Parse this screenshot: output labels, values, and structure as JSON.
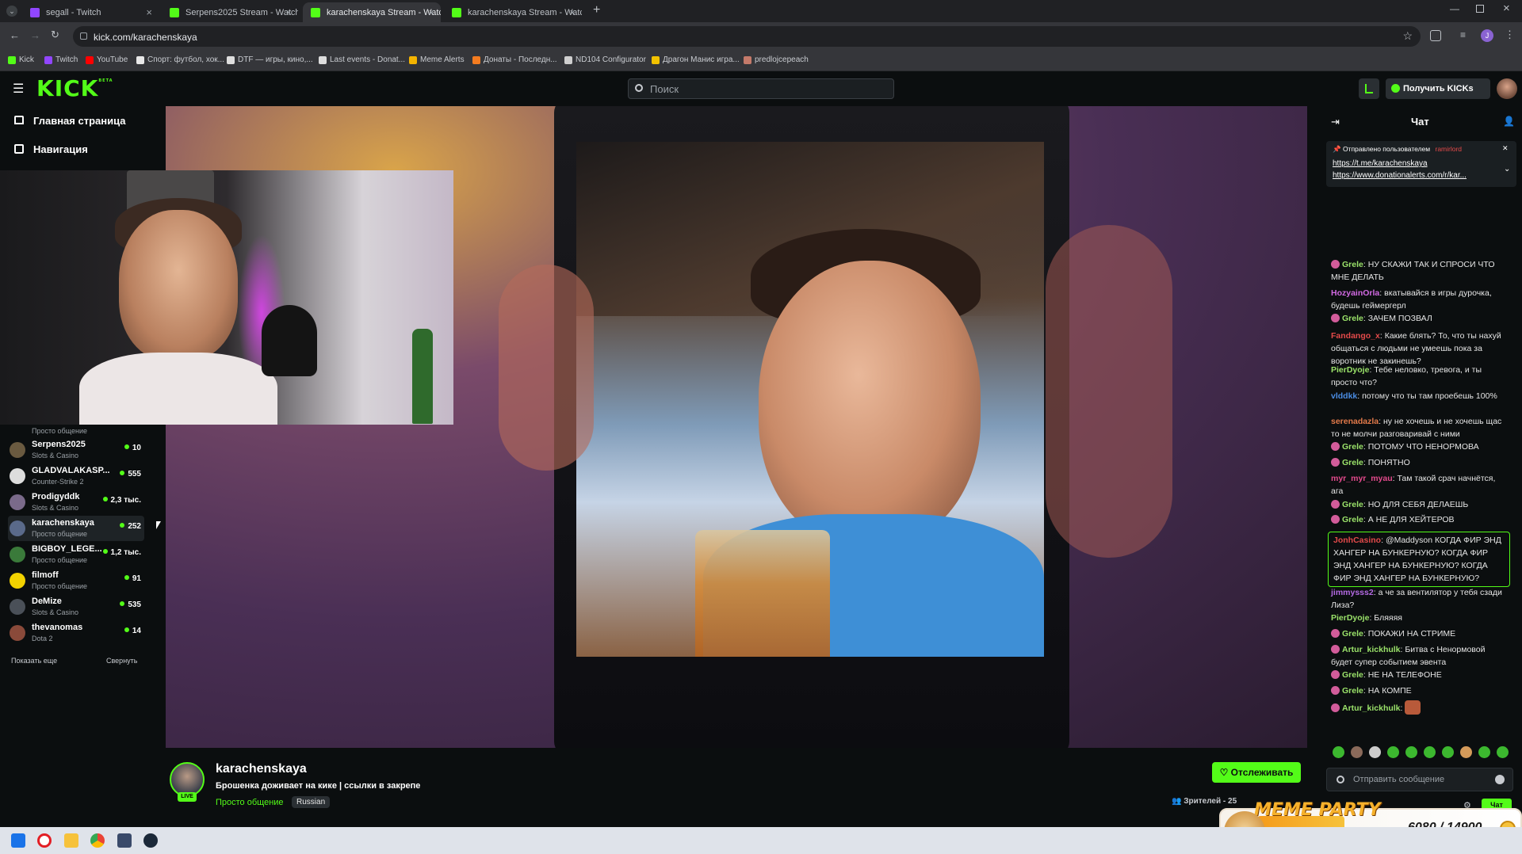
{
  "browser": {
    "tabs": [
      {
        "title": "segall - Twitch",
        "favicon": "twitch-icon"
      },
      {
        "title": "Serpens2025 Stream - Watch L",
        "favicon": "kick-icon"
      },
      {
        "title": "karachenskaya Stream - Watch",
        "favicon": "kick-icon",
        "active": true
      },
      {
        "title": "karachenskaya Stream - Watch",
        "favicon": "kick-icon"
      }
    ],
    "url": "kick.com/karachenskaya",
    "bookmarks": [
      "Kick",
      "Twitch",
      "YouTube",
      "Спорт: футбол, хок...",
      "DTF — игры, кино,...",
      "Last events - Donat...",
      "Meme Alerts",
      "Донаты - Последн...",
      "ND104 Configurator",
      "Драгон Манис игра...",
      "predlojcepeach"
    ]
  },
  "header": {
    "logo": "KICK",
    "logo_superscript": "BETA",
    "search_placeholder": "Поиск",
    "get_kicks_label": "Получить KICKs"
  },
  "sidebar": {
    "nav": [
      {
        "label": "Главная страница",
        "icon": "home-icon"
      },
      {
        "label": "Навигация",
        "icon": "compass-icon"
      }
    ],
    "partial_category": "Просто общение",
    "channels": [
      {
        "name": "Serpens2025",
        "category": "Slots & Casino",
        "viewers": "10"
      },
      {
        "name": "GLADVALAKASP...",
        "category": "Counter-Strike 2",
        "viewers": "555"
      },
      {
        "name": "Prodigyddk",
        "category": "Slots & Casino",
        "viewers": "2,3 тыс."
      },
      {
        "name": "karachenskaya",
        "category": "Просто общение",
        "viewers": "252",
        "selected": true
      },
      {
        "name": "BIGBOY_LEGE...",
        "category": "Просто общение",
        "viewers": "1,2 тыс."
      },
      {
        "name": "filmoff",
        "category": "Просто общение",
        "viewers": "91"
      },
      {
        "name": "DeMize",
        "category": "Slots & Casino",
        "viewers": "535"
      },
      {
        "name": "thevanomas",
        "category": "Dota 2",
        "viewers": "14"
      }
    ],
    "show_more": "Показать еще",
    "collapse": "Свернуть"
  },
  "stream": {
    "channel_name": "karachenskaya",
    "title": "Брошенка доживает на кике | ссылки в закрепе",
    "category": "Просто общение",
    "language_tag": "Russian",
    "live_badge": "LIVE",
    "follow_label": "Отслеживать",
    "viewers_label": "Зрителей - 25"
  },
  "chat": {
    "title": "Чат",
    "pinned_header": "Отправлено пользователем",
    "pinned_user": "ramirlord",
    "pinned_links": [
      "https://t.me/karachenskaya",
      "https://www.donationalerts.com/r/kar..."
    ],
    "messages": [
      {
        "user": "Grele",
        "color": "#9be36a",
        "badge": true,
        "text": "НУ СКАЖИ ТАК И СПРОСИ ЧТО МНЕ ДЕЛАТЬ"
      },
      {
        "user": "HozyainOrla",
        "color": "#d26ae3",
        "text": "вкатывайся в игры дурочка, будешь геймергерл"
      },
      {
        "user": "Grele",
        "color": "#9be36a",
        "badge": true,
        "text": "ЗАЧЕМ ПОЗВАЛ"
      },
      {
        "user": "Fandango_x",
        "color": "#e34a4a",
        "text": "Какие блять? То, что ты нахуй общаться с людьми не умеешь пока за воротник не закинешь?"
      },
      {
        "user": "PierDyoje",
        "color": "#9be36a",
        "text": "Тебе неловко, тревога, и ты просто что?"
      },
      {
        "user": "vlddkk",
        "color": "#4a8ce3",
        "text": "потому что ты там проебешь 100%"
      },
      {
        "user": "serenadazla",
        "color": "#e37a4a",
        "text": "ну не хочешь и не хочешь щас то не молчи разговаривай с ними"
      },
      {
        "user": "Grele",
        "color": "#9be36a",
        "badge": true,
        "text": "ПОТОМУ ЧТО НЕНОРМОВА"
      },
      {
        "user": "Grele",
        "color": "#9be36a",
        "badge": true,
        "text": "ПОНЯТНО"
      },
      {
        "user": "myr_myr_myau",
        "color": "#e34a8c",
        "text": "Там такой срач начнётся, ага"
      },
      {
        "user": "Grele",
        "color": "#9be36a",
        "badge": true,
        "text": "НО ДЛЯ СЕБЯ ДЕЛАЕШЬ"
      },
      {
        "user": "Grele",
        "color": "#9be36a",
        "badge": true,
        "text": "А НЕ ДЛЯ ХЕЙТЕРОВ"
      },
      {
        "user": "JonhCasino",
        "color": "#e34a4a",
        "highlight": true,
        "text": "@Maddyson КОГДА ФИР ЭНД ХАНГЕР НА БУНКЕРНУЮ? КОГДА ФИР ЭНД ХАНГЕР НА БУНКЕРНУЮ? КОГДА ФИР ЭНД ХАНГЕР НА БУНКЕРНУЮ?"
      },
      {
        "user": "jimmysss2",
        "color": "#b46ae3",
        "text": "а че за вентилятор у тебя сзади Лиза?"
      },
      {
        "user": "PierDyoje",
        "color": "#9be36a",
        "text": "Бляяяя"
      },
      {
        "user": "Grele",
        "color": "#9be36a",
        "badge": true,
        "text": "ПОКАЖИ НА СТРИМЕ"
      },
      {
        "user": "Artur_kickhulk",
        "color": "#9be36a",
        "badge": true,
        "text": "Битва с Ненормовой будет супер событием эвента"
      },
      {
        "user": "Grele",
        "color": "#9be36a",
        "badge": true,
        "text": "НЕ НА ТЕЛЕФОНЕ"
      },
      {
        "user": "Grele",
        "color": "#9be36a",
        "badge": true,
        "text": "НА КОМПЕ"
      },
      {
        "user": "Artur_kickhulk",
        "color": "#9be36a",
        "badge": true,
        "text": ""
      }
    ],
    "input_placeholder": "Отправить сообщение",
    "chat_button": "Чат"
  },
  "overlay": {
    "title": "MEME PARTY",
    "progress": "6080 / 14900",
    "progress_current": 6080,
    "progress_total": 14900
  },
  "colors": {
    "accent": "#53fc18",
    "background": "#0b0e0f"
  }
}
